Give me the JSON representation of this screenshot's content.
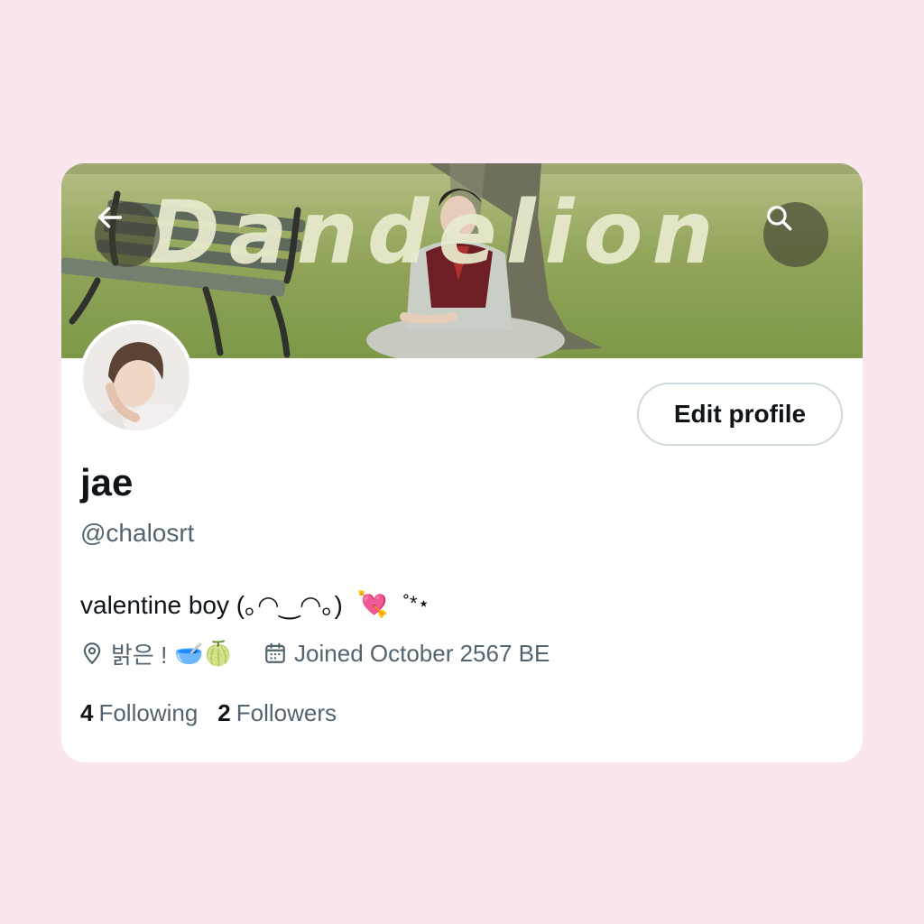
{
  "banner": {
    "title": "Dandelion",
    "back_icon": "arrow-left-icon",
    "search_icon": "search-icon"
  },
  "profile": {
    "name": "jae",
    "handle": "@chalosrt",
    "edit_button_label": "Edit profile",
    "bio": {
      "text": "valentine boy (｡◠‿◠｡)",
      "emoji": "💘",
      "trailing": "˚*⋆"
    },
    "location": {
      "icon": "location-pin-icon",
      "text": "밝은 !",
      "emojis": "🥣🍈"
    },
    "joined": {
      "icon": "calendar-icon",
      "text": "Joined October 2567 BE"
    },
    "stats": {
      "following_count": "4",
      "following_label": "Following",
      "followers_count": "2",
      "followers_label": "Followers"
    }
  },
  "colors": {
    "page_background": "#f9e6ef",
    "card_background": "#ffffff",
    "text_primary": "#0f1419",
    "text_secondary": "#536471",
    "button_border": "#cfd9de"
  }
}
